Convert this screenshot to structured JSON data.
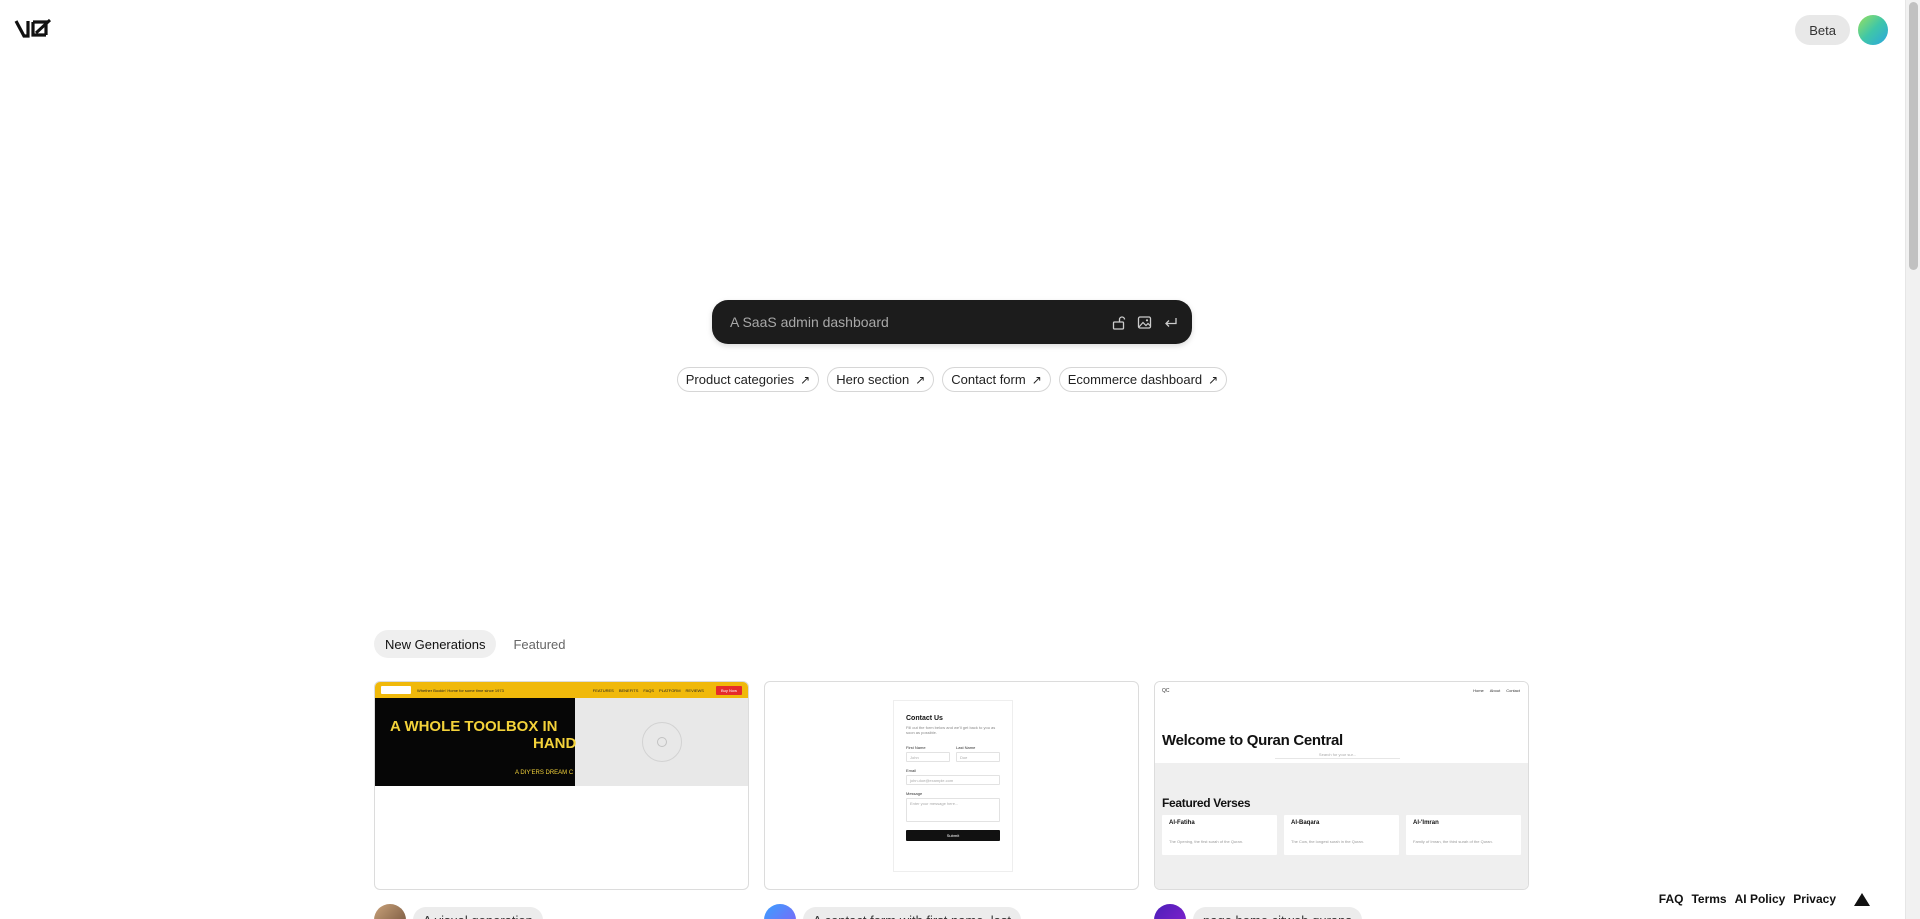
{
  "header": {
    "logo_text": "v0",
    "beta_label": "Beta"
  },
  "prompt": {
    "placeholder": "A SaaS admin dashboard",
    "icons": [
      "unlock-icon",
      "image-icon",
      "enter-icon"
    ]
  },
  "suggestions": [
    {
      "label": "Product categories",
      "icon": "arrow-up-right-icon"
    },
    {
      "label": "Hero section",
      "icon": "arrow-up-right-icon"
    },
    {
      "label": "Contact form",
      "icon": "arrow-up-right-icon"
    },
    {
      "label": "Ecommerce dashboard",
      "icon": "arrow-up-right-icon"
    }
  ],
  "tabs": [
    {
      "label": "New Generations",
      "active": true
    },
    {
      "label": "Featured",
      "active": false
    }
  ],
  "cards": [
    {
      "caption": "A visual generation",
      "preview": {
        "topbar_text": "Whether Bookin' Home for some time since 1973",
        "nav_links": [
          "FEATURES",
          "BENEFITS",
          "FAQS",
          "PLATFORM",
          "REVIEWS"
        ],
        "buy_label": "Buy Now",
        "headline_line1": "A WHOLE TOOLBOX IN",
        "headline_line2": "HAND",
        "subhead": "A DIY'ERS DREAM C"
      }
    },
    {
      "caption": "A contact form with first name, last",
      "preview": {
        "title": "Contact Us",
        "description": "Fill out the form below and we'll get back to you as soon as possible.",
        "first_name_label": "First Name",
        "first_name_placeholder": "John",
        "last_name_label": "Last Name",
        "last_name_placeholder": "Doe",
        "email_label": "Email",
        "email_placeholder": "john.doe@example.com",
        "message_label": "Message",
        "message_placeholder": "Enter your message here...",
        "submit_label": "Submit"
      }
    },
    {
      "caption": "page home citweb qurans",
      "preview": {
        "mark": "QC",
        "nav_links": [
          "Home",
          "About",
          "Contact"
        ],
        "headline": "Welcome to Quran Central",
        "search_placeholder": "Search for your sur...",
        "section_title": "Featured Verses",
        "verses": [
          {
            "name": "Al-Fatiha",
            "desc": "The Opening, the first surah of the Quran."
          },
          {
            "name": "Al-Baqara",
            "desc": "The Cow, the longest surah in the Quran."
          },
          {
            "name": "Al-'Imran",
            "desc": "Family of Imran, the third surah of the Quran."
          }
        ]
      }
    }
  ],
  "footer": {
    "links": [
      "FAQ",
      "Terms",
      "AI Policy",
      "Privacy"
    ]
  },
  "colors": {
    "prompt_bg": "#1c1c1c",
    "card1_topbar": "#f0b90b",
    "card1_headline": "#f3d23a",
    "card1_buy": "#e62b2b"
  }
}
